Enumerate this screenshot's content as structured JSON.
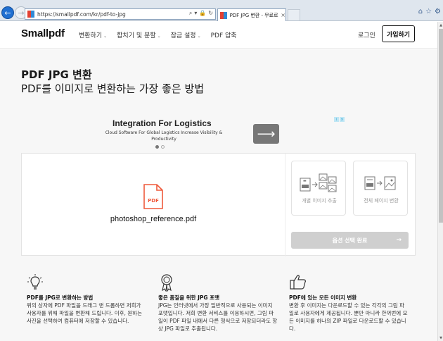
{
  "browser": {
    "url": "https://smallpdf.com/kr/pdf-to-jpg",
    "tab_title": "PDF JPG 변환 - 무료로 온...",
    "back_glyph": "←",
    "forward_glyph": "→",
    "tab_close_glyph": "×",
    "address_tools": [
      "⌕",
      "▾",
      "🔒",
      "↻"
    ],
    "right_icons": [
      "⌂",
      "☆",
      "⚙"
    ]
  },
  "header": {
    "logo": "Smallpdf",
    "menu": [
      {
        "label": "변환하기"
      },
      {
        "label": "합치기 및 분할"
      },
      {
        "label": "잠금 설정"
      },
      {
        "label": "PDF 압축"
      }
    ],
    "caret_glyph": "⌄",
    "login_label": "로그인",
    "signup_label": "가입하기"
  },
  "hero": {
    "title": "PDF JPG 변환",
    "subtitle": "PDF를 이미지로 변환하는 가장 좋은 방법"
  },
  "ad": {
    "title": "Integration For Logistics",
    "subtitle": "Cloud Software For Global Logistics Increase Visibility & Productivity",
    "arrow_glyph": "⟶",
    "badge_info": "i",
    "badge_close": "×",
    "carousel_active_index": 0
  },
  "converter": {
    "file_icon_label": "PDF",
    "filename": "photoshop_reference.pdf",
    "options": [
      {
        "label": "개별 이미지 추출"
      },
      {
        "label": "전체 페이지 변환"
      }
    ],
    "choose_button_label": "옵션 선택 완료",
    "choose_button_arrow": "→"
  },
  "features": [
    {
      "icon": "lightbulb-icon",
      "title": "PDF를 JPG로 변환하는 방법",
      "text": "위의 상자에 PDF 파일을 드래그 앤 드롭하면 저희가 사용자를 위해 파일을 변환해 드립니다. 이후, 원하는 사진을 선택하여 컴퓨터에 저장할 수 있습니다."
    },
    {
      "icon": "award-ribbon-icon",
      "title": "좋은 품질을 위한 JPG 포맷",
      "text": "JPG는 인터넷에서 가장 일반적으로 사용되는 이미지 포맷입니다. 저희 변환 서비스를 이용하시면, 그림 파일이 PDF 파일 내에서 다른 형식으로 저장되더라도 항상 JPG 파일로 추출됩니다."
    },
    {
      "icon": "thumbs-up-icon",
      "title": "PDF에 있는 모든 이미지 변환",
      "text": "변환 후 이미지는 다운로드할 수 있는 각각의 그림 파일로 사용자에게 제공됩니다. 뿐만 아니라 한꺼번에 모든 이미지를 하나의 ZIP 파일로 다운로드할 수 있습니다."
    }
  ],
  "scrollbar": {
    "up_glyph": "▲",
    "down_glyph": "▼"
  }
}
